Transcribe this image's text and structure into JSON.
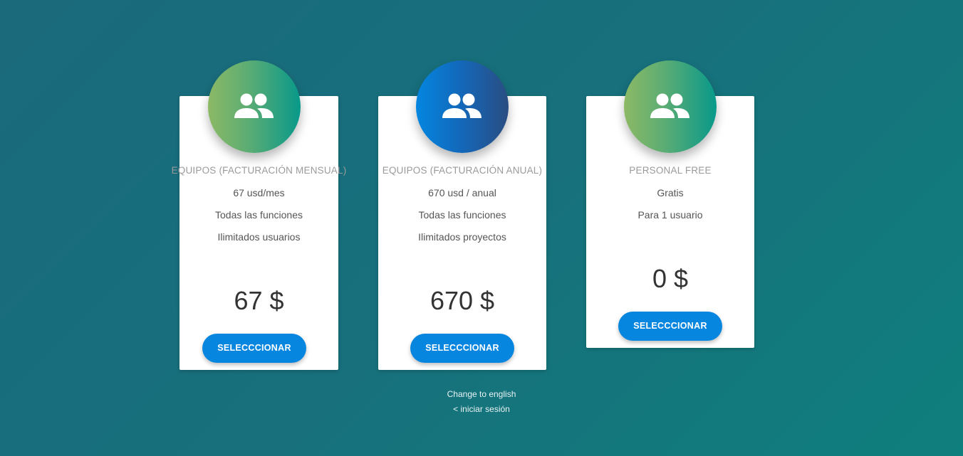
{
  "plans": [
    {
      "title": "EQUIPOS (FACTURACIÓN MENSUAL)",
      "features": [
        "67 usd/mes",
        "Todas las funciones",
        "Ilimitados usuarios"
      ],
      "price": "67 $",
      "button_label": "SELECCCIONAR",
      "icon": "group-icon",
      "badge_color": "green-gradient"
    },
    {
      "title": "EQUIPOS (FACTURACIÓN ANUAL)",
      "features": [
        "670 usd / anual",
        "Todas las funciones",
        "Ilimitados proyectos"
      ],
      "price": "670 $",
      "button_label": "SELECCCIONAR",
      "icon": "group-icon",
      "badge_color": "blue-gradient"
    },
    {
      "title": "PERSONAL FREE",
      "features": [
        "Gratis",
        "Para 1 usuario"
      ],
      "price": "0 $",
      "button_label": "SELECCCIONAR",
      "icon": "group-icon",
      "badge_color": "green-gradient"
    }
  ],
  "footer": {
    "language_link": "Change to english",
    "login_link": "< iniciar sesión"
  },
  "colors": {
    "background": "#17707c",
    "button": "#0786df",
    "badge_green_start": "#8cb965",
    "badge_green_end": "#08998a",
    "badge_blue_start": "#0386e0",
    "badge_blue_end": "#2a4d82"
  }
}
